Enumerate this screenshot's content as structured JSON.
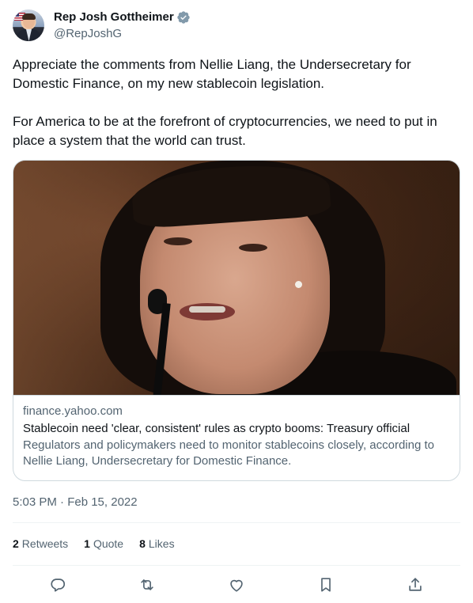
{
  "author": {
    "display_name": "Rep Josh Gottheimer",
    "handle": "@RepJoshG",
    "verified_icon": "verified-badge-icon"
  },
  "tweet": {
    "paragraphs": [
      "Appreciate the comments from Nellie Liang, the Undersecretary for Domestic Finance, on my new stablecoin legislation.",
      "For America to be at the forefront of cryptocurrencies, we need to put in place a system that the world can trust."
    ],
    "timestamp": "5:03 PM · Feb 15, 2022"
  },
  "card": {
    "domain": "finance.yahoo.com",
    "title": "Stablecoin need 'clear, consistent' rules as crypto booms: Treasury official",
    "description": "Regulators and policymakers need to monitor stablecoins closely, according to Nellie Liang, Undersecretary for Domestic Finance."
  },
  "stats": {
    "retweets_count": "2",
    "retweets_label": "Retweets",
    "quotes_count": "1",
    "quotes_label": "Quote",
    "likes_count": "8",
    "likes_label": "Likes"
  },
  "actions": {
    "reply_icon": "reply-icon",
    "retweet_icon": "retweet-icon",
    "like_icon": "heart-icon",
    "bookmark_icon": "bookmark-icon",
    "share_icon": "share-icon"
  },
  "colors": {
    "text_primary": "#0f1419",
    "text_secondary": "#536471",
    "border": "#cfd9de",
    "verified": "#829aab"
  }
}
